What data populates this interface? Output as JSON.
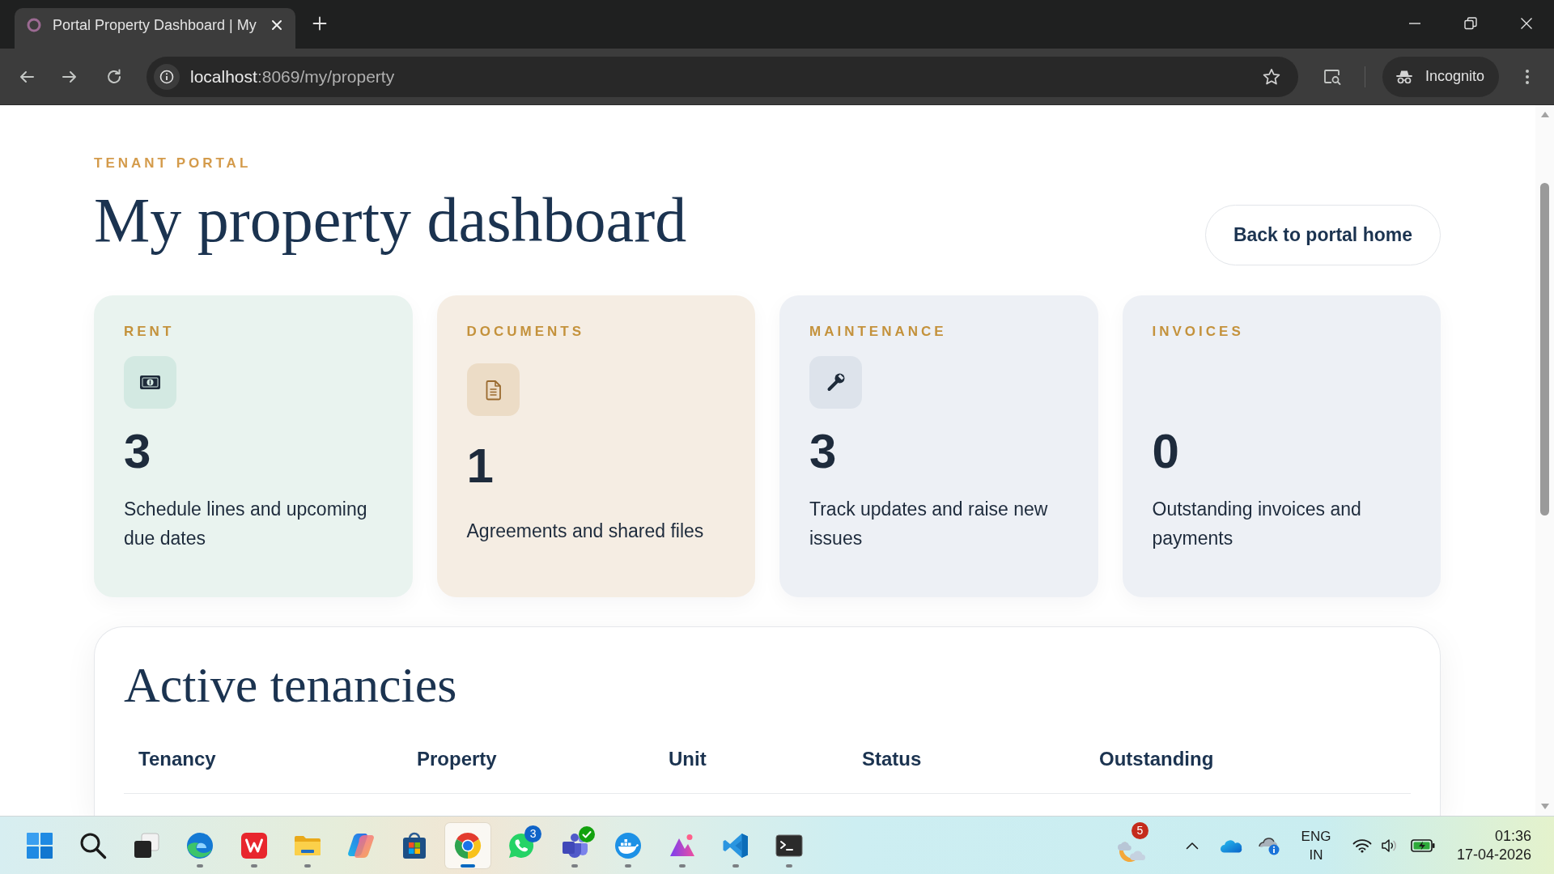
{
  "browser": {
    "tabs": [
      {
        "title": "Portal Property Dashboard | My",
        "selected": true
      }
    ],
    "url": {
      "host": "localhost",
      "path": ":8069/my/property"
    },
    "profile": "Incognito"
  },
  "page": {
    "eyebrow": "TENANT PORTAL",
    "title": "My property dashboard",
    "back_button": "Back to portal home"
  },
  "cards": [
    {
      "kind": "rent",
      "label": "RENT",
      "count": "3",
      "description": "Schedule lines and upcoming due dates"
    },
    {
      "kind": "documents",
      "label": "DOCUMENTS",
      "count": "1",
      "description": "Agreements and shared files"
    },
    {
      "kind": "maintenance",
      "label": "MAINTENANCE",
      "count": "3",
      "description": "Track updates and raise new issues"
    },
    {
      "kind": "invoices",
      "label": "INVOICES",
      "count": "0",
      "description": "Outstanding invoices and payments"
    }
  ],
  "tenancies": {
    "title": "Active tenancies",
    "columns": [
      "Tenancy",
      "Property",
      "Unit",
      "Status",
      "Outstanding"
    ]
  },
  "taskbar": {
    "apps": [
      {
        "kind": "start",
        "running": false,
        "selected": false
      },
      {
        "kind": "search",
        "running": false,
        "selected": false
      },
      {
        "kind": "taskview",
        "running": false,
        "selected": false
      },
      {
        "kind": "edge",
        "running": true,
        "selected": false
      },
      {
        "kind": "wps",
        "running": true,
        "selected": false
      },
      {
        "kind": "folder",
        "running": true,
        "selected": false
      },
      {
        "kind": "copilot",
        "running": false,
        "selected": false
      },
      {
        "kind": "store",
        "running": false,
        "selected": false
      },
      {
        "kind": "chrome",
        "running": true,
        "selected": true
      },
      {
        "kind": "chat",
        "running": false,
        "selected": false,
        "badge": "3"
      },
      {
        "kind": "teams",
        "running": true,
        "selected": false
      },
      {
        "kind": "whale",
        "running": true,
        "selected": false
      },
      {
        "kind": "arc",
        "running": true,
        "selected": false
      },
      {
        "kind": "code",
        "running": true,
        "selected": false
      },
      {
        "kind": "terminal",
        "running": true,
        "selected": false
      }
    ],
    "tray": {
      "weather_badge": "5",
      "language": "ENG",
      "region": "IN",
      "time": "01:36",
      "date": "17-04-2026"
    }
  }
}
